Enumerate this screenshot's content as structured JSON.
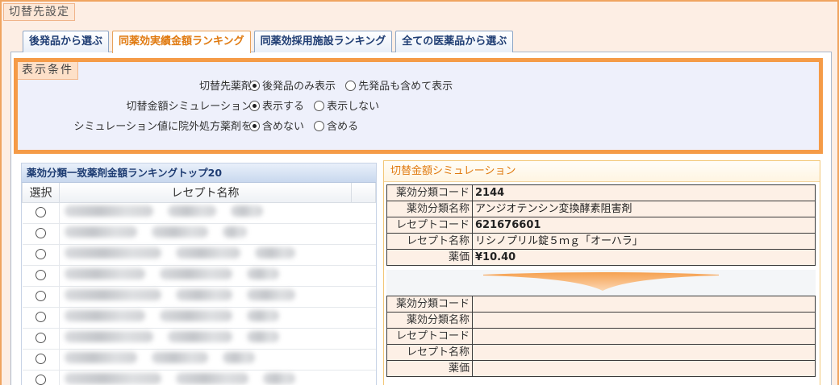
{
  "window": {
    "title": "切替先設定"
  },
  "tabs": [
    {
      "label": "後発品から選ぶ",
      "active": false
    },
    {
      "label": "同薬効実績金額ランキング",
      "active": true
    },
    {
      "label": "同薬効採用施設ランキング",
      "active": false
    },
    {
      "label": "全ての医薬品から選ぶ",
      "active": false
    }
  ],
  "conditions": {
    "title": "表示条件",
    "rows": [
      {
        "label": "切替先薬剤",
        "options": [
          {
            "label": "後発品のみ表示",
            "selected": true
          },
          {
            "label": "先発品も含めて表示",
            "selected": false
          }
        ]
      },
      {
        "label": "切替金額シミュレーション",
        "options": [
          {
            "label": "表示する",
            "selected": true
          },
          {
            "label": "表示しない",
            "selected": false
          }
        ]
      },
      {
        "label": "シミュレーション値に院外処方薬剤を",
        "options": [
          {
            "label": "含めない",
            "selected": true
          },
          {
            "label": "含める",
            "selected": false
          }
        ]
      }
    ]
  },
  "ranking": {
    "title": "薬効分類一致薬剤金額ランキングトップ20",
    "columns": {
      "select": "選択",
      "name": "レセプト名称"
    },
    "row_count": 9
  },
  "simulation": {
    "title": "切替金額シミュレーション",
    "from": {
      "code_label": "薬効分類コード",
      "code": "2144",
      "class_label": "薬効分類名称",
      "class_name": "アンジオテンシン変換酵素阻害剤",
      "receipt_code_label": "レセプトコード",
      "receipt_code": "621676601",
      "receipt_name_label": "レセプト名称",
      "receipt_name": "リシノプリル錠５ｍｇ「オーハラ」",
      "price_label": "薬価",
      "price": "¥10.40"
    },
    "to": {
      "code_label": "薬効分類コード",
      "code": "",
      "class_label": "薬効分類名称",
      "class_name": "",
      "receipt_code_label": "レセプトコード",
      "receipt_code": "",
      "receipt_name_label": "レセプト名称",
      "receipt_name": "",
      "price_label": "薬価",
      "price": ""
    }
  },
  "colors": {
    "accent_orange": "#f59b47",
    "tab_active_text": "#e07a10",
    "tab_text": "#1f3d73"
  }
}
